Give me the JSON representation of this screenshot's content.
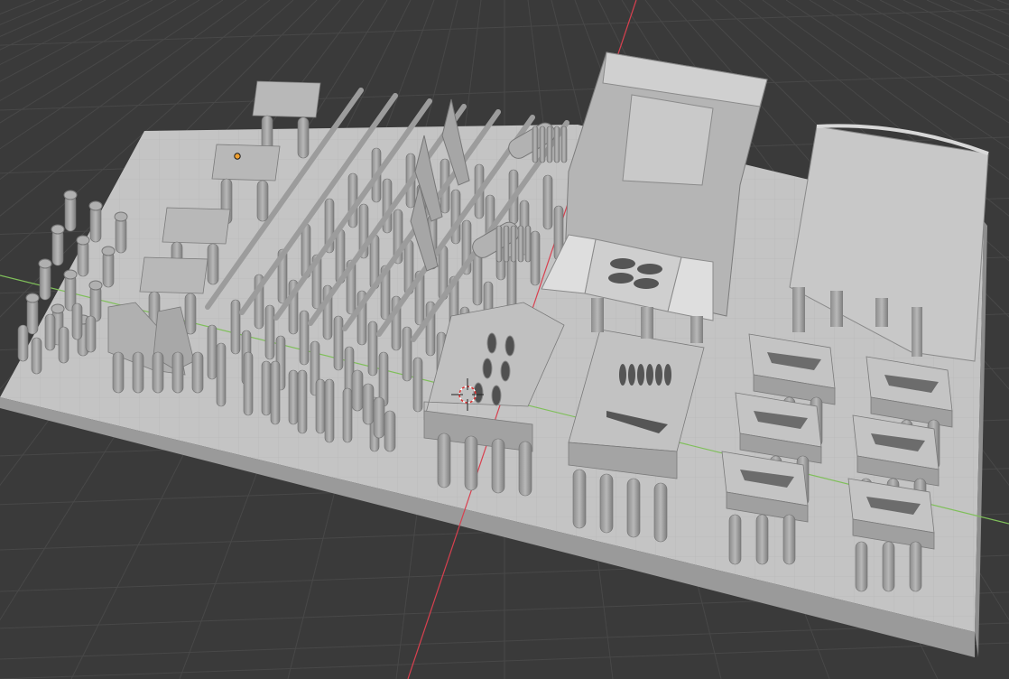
{
  "app": "3D Viewport",
  "colors": {
    "background": "#3a3a3a",
    "grid_line": "#474747",
    "plate_top": "#c9c9c9",
    "plate_side": "#9c9c9c",
    "part_light": "#bdbdbd",
    "part_mid": "#a9a9a9",
    "part_dark": "#8a8a8a",
    "axis_x": "#8fd16a",
    "axis_y": "#e0465a",
    "origin_point": "#f0a030"
  },
  "icons": {
    "cursor": "3d-cursor-icon",
    "origin": "object-origin-icon"
  }
}
